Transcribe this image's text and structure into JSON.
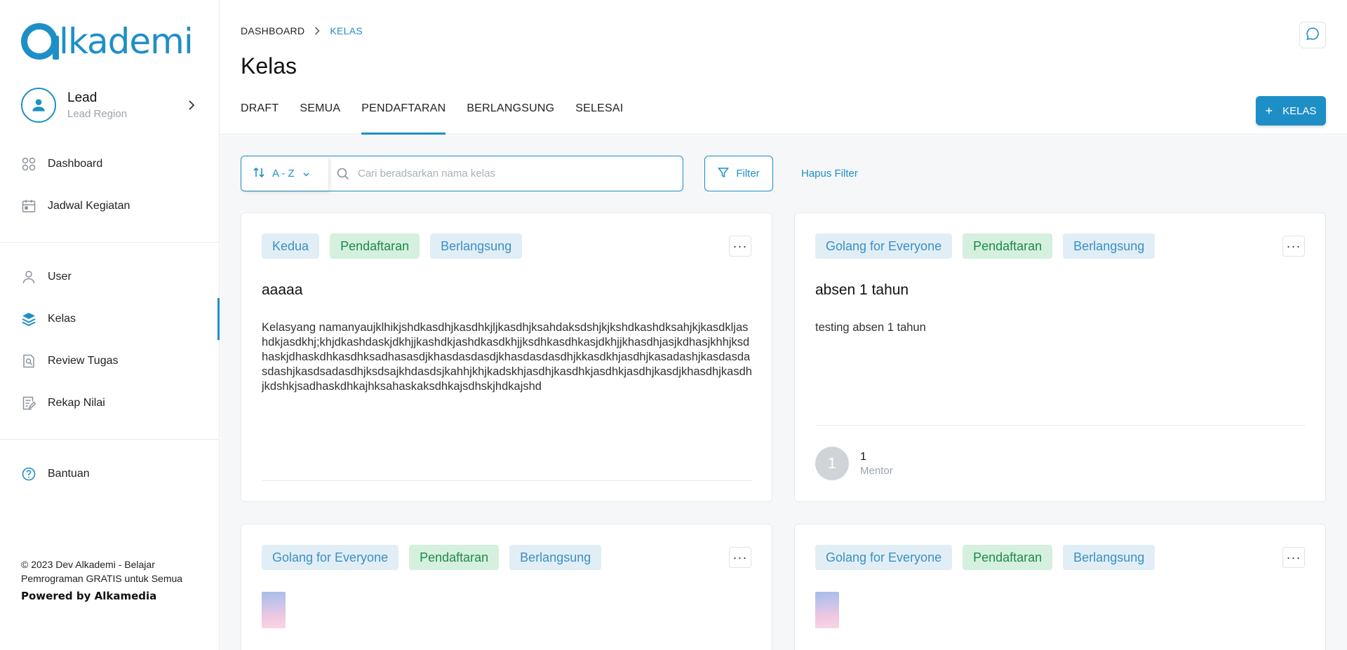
{
  "brand": {
    "logo_text": "lkademi",
    "accent": "#1e8fc6"
  },
  "profile": {
    "name": "Lead",
    "role": "Lead Region"
  },
  "sidebar": {
    "items": [
      {
        "label": "Dashboard",
        "icon": "grid-icon"
      },
      {
        "label": "Jadwal Kegiatan",
        "icon": "calendar-icon"
      },
      {
        "label": "User",
        "icon": "user-icon"
      },
      {
        "label": "Kelas",
        "icon": "layers-icon",
        "active": true
      },
      {
        "label": "Review Tugas",
        "icon": "review-icon"
      },
      {
        "label": "Rekap Nilai",
        "icon": "edit-note-icon"
      },
      {
        "label": "Bantuan",
        "icon": "help-icon"
      }
    ],
    "footer_copy": "© 2023 Dev Alkademi - Belajar Pemrograman GRATIS untuk Semua",
    "footer_power": "Powered by Alkamedia"
  },
  "header": {
    "breadcrumb": [
      "DASHBOARD",
      "KELAS"
    ],
    "title": "Kelas",
    "tabs": [
      {
        "label": "DRAFT"
      },
      {
        "label": "SEMUA"
      },
      {
        "label": "PENDAFTARAN",
        "active": true
      },
      {
        "label": "BERLANGSUNG"
      },
      {
        "label": "SELESAI"
      }
    ],
    "add_button": "KELAS"
  },
  "toolbar": {
    "sort_label": "A - Z",
    "search_placeholder": "Cari beradsarkan nama kelas",
    "filter_label": "Filter",
    "clear_label": "Hapus Filter"
  },
  "cards": [
    {
      "tags": [
        "Kedua",
        "Pendaftaran",
        "Berlangsung"
      ],
      "title": "aaaaa",
      "description": "Kelasyang namanyaujklhikjshdkasdhjkasdhkjljkasdhjksahdaksdshjkjkshdkashdksahjkjkasdkljashdkjasdkhj;khjdkashdaskjdkhjjkashdkjashdkasdkhjjksdhkasdhkasjdkhjjkhasdhjasjkdhasjkhhjksdhaskjdhaskdhkasdhksadhasasdjkhasdasdasdjkhasdasdasdhjkkasdkhjasdhjkasadashjkasdasdasdashjkasdsadasdhjksdsajkhdasdsjkahhjkhjkadskhjasdhjkasdhkjasdhkjasdhjkasdjkhasdhjkasdhjkdshkjsadhaskdhkajhksahaskaksdhkajsdhskjhdkajshd"
    },
    {
      "tags": [
        "Golang for Everyone",
        "Pendaftaran",
        "Berlangsung"
      ],
      "title": "absen 1 tahun",
      "description": "testing absen 1 tahun",
      "mentor_count": "1",
      "mentor_label": "Mentor",
      "mentor_initial": "1"
    },
    {
      "tags": [
        "Golang for Everyone",
        "Pendaftaran",
        "Berlangsung"
      ]
    },
    {
      "tags": [
        "Golang for Everyone",
        "Pendaftaran",
        "Berlangsung"
      ]
    }
  ]
}
